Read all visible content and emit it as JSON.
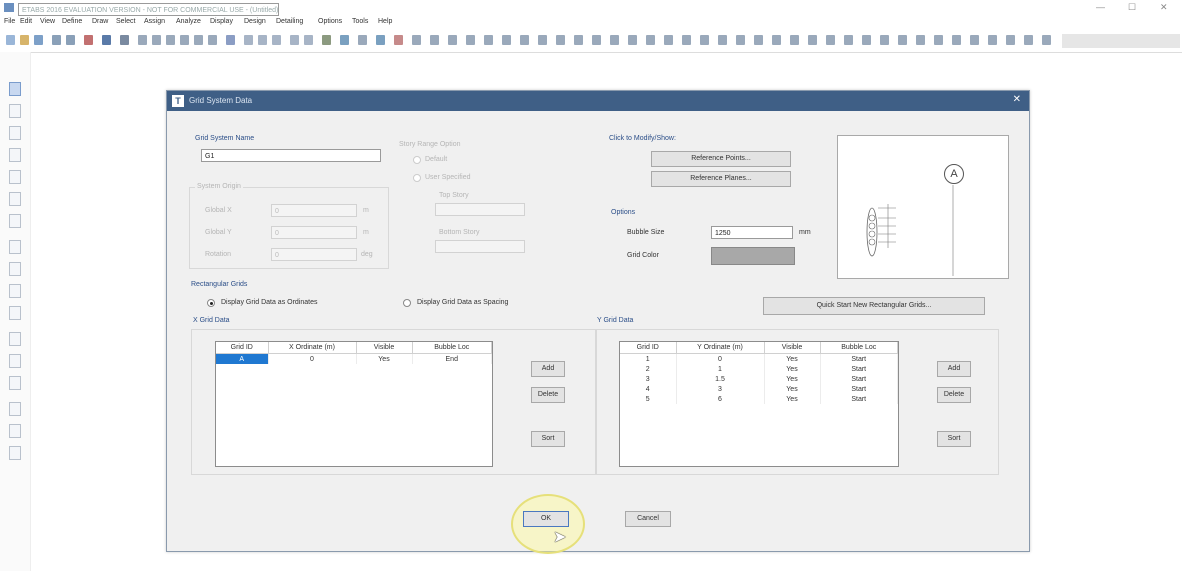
{
  "app": {
    "title": "ETABS 2016 EVALUATION VERSION - NOT FOR COMMERCIAL USE - (Untitled)",
    "window_controls": [
      "—",
      "☐",
      "✕"
    ]
  },
  "menu": [
    "File",
    "Edit",
    "View",
    "Define",
    "Draw",
    "Select",
    "Assign",
    "Analyze",
    "Display",
    "Design",
    "Detailing",
    "Options",
    "Tools",
    "Help"
  ],
  "dialog": {
    "title": "Grid System Data",
    "close": "✕",
    "grid_system_name": {
      "label": "Grid System Name",
      "value": "G1"
    },
    "system_origin": {
      "label": "System Origin",
      "fields": [
        {
          "label": "Global X",
          "value": "0",
          "unit": "m"
        },
        {
          "label": "Global Y",
          "value": "0",
          "unit": "m"
        },
        {
          "label": "Rotation",
          "value": "0",
          "unit": "deg"
        }
      ]
    },
    "story_range": {
      "label": "Story Range Option",
      "default": "Default",
      "user_specified": "User Specified",
      "top_story": "Top Story",
      "bottom_story": "Bottom Story"
    },
    "click_to_modify": {
      "label": "Click to Modify/Show:",
      "reference_points": "Reference Points...",
      "reference_planes": "Reference Planes..."
    },
    "options": {
      "label": "Options",
      "bubble_size_label": "Bubble Size",
      "bubble_size_value": "1250",
      "bubble_size_unit": "mm",
      "grid_color_label": "Grid Color",
      "grid_color": "#a8a8a8"
    },
    "preview": {
      "bubble_label": "A"
    },
    "rectangular_grids": {
      "label": "Rectangular Grids",
      "opt_ordinates": "Display Grid Data as Ordinates",
      "opt_spacing": "Display Grid Data as Spacing",
      "quick_start": "Quick Start New Rectangular Grids..."
    },
    "x_grid": {
      "label": "X Grid Data",
      "headers": [
        "Grid ID",
        "X Ordinate (m)",
        "Visible",
        "Bubble Loc"
      ],
      "rows": [
        [
          "A",
          "0",
          "Yes",
          "End"
        ]
      ],
      "add": "Add",
      "delete": "Delete",
      "sort": "Sort"
    },
    "y_grid": {
      "label": "Y Grid Data",
      "headers": [
        "Grid ID",
        "Y Ordinate (m)",
        "Visible",
        "Bubble Loc"
      ],
      "rows": [
        [
          "1",
          "0",
          "Yes",
          "Start"
        ],
        [
          "2",
          "1",
          "Yes",
          "Start"
        ],
        [
          "3",
          "1.5",
          "Yes",
          "Start"
        ],
        [
          "4",
          "3",
          "Yes",
          "Start"
        ],
        [
          "5",
          "6",
          "Yes",
          "Start"
        ]
      ],
      "add": "Add",
      "delete": "Delete",
      "sort": "Sort"
    },
    "ok": "OK",
    "cancel": "Cancel"
  }
}
